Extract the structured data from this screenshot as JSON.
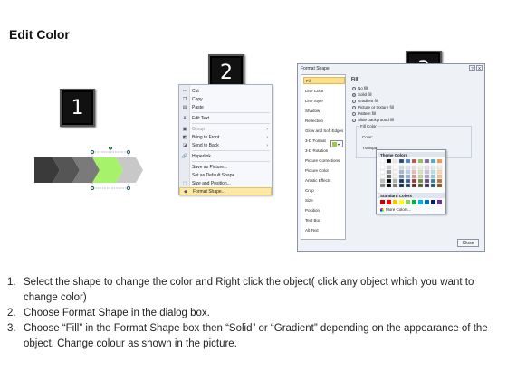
{
  "title": "Edit Color",
  "badges": [
    "1",
    "2",
    "3"
  ],
  "colors": {
    "highlight_green": "#a6f26a",
    "dark_gray": "#444444",
    "badge_black": "#111111",
    "menu_highlight": "#fde9a6"
  },
  "context_menu": {
    "items": [
      {
        "label": "Cut",
        "icon": "scissors-icon"
      },
      {
        "label": "Copy",
        "icon": "copy-icon"
      },
      {
        "label": "Paste",
        "icon": "paste-icon"
      },
      {
        "label": "Edit Text",
        "icon": "text-icon"
      },
      {
        "label": "Group",
        "icon": "group-icon",
        "submenu": true,
        "disabled": true
      },
      {
        "label": "Bring to Front",
        "icon": "bring-front-icon",
        "submenu": true
      },
      {
        "label": "Send to Back",
        "icon": "send-back-icon",
        "submenu": true
      },
      {
        "label": "Hyperlink...",
        "icon": "hyperlink-icon"
      },
      {
        "label": "Save as Picture...",
        "icon": ""
      },
      {
        "label": "Set as Default Shape",
        "icon": ""
      },
      {
        "label": "Size and Position...",
        "icon": "size-icon"
      },
      {
        "label": "Format Shape...",
        "icon": "format-icon",
        "highlighted": true
      }
    ]
  },
  "dialog": {
    "title": "Format Shape",
    "controls": [
      "?",
      "X"
    ],
    "categories": [
      "Fill",
      "Line Color",
      "Line Style",
      "Shadow",
      "Reflection",
      "Glow and Soft Edges",
      "3-D Format",
      "3-D Rotation",
      "Picture Corrections",
      "Picture Color",
      "Artistic Effects",
      "Crop",
      "Size",
      "Position",
      "Text Box",
      "Alt Text"
    ],
    "pane_header": "Fill",
    "options": [
      "No fill",
      "Solid fill",
      "Gradient fill",
      "Picture or texture fill",
      "Pattern fill",
      "Slide background fill"
    ],
    "selected_option": "Solid fill",
    "group_label": "Fill Color",
    "color_label": "Color:",
    "transparency_label": "Transpa",
    "close_label": "Close"
  },
  "picker": {
    "theme_label": "Theme Colors",
    "standard_label": "Standard Colors",
    "more_label": "More Colors..."
  },
  "steps": [
    {
      "num": "1.",
      "text": "Select the shape to change the color and Right click the object( click any object which you want to change color)"
    },
    {
      "num": "2.",
      "text": "Choose Format Shape in the dialog box."
    },
    {
      "num": "3.",
      "text": "Choose “Fill” in the Format Shape box then “Solid” or “Gradient” depending on the appearance of the object. Change colour as shown in the picture."
    }
  ]
}
